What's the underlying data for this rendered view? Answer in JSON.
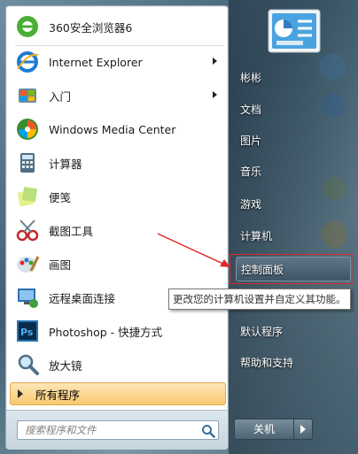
{
  "left_items": [
    {
      "label": "360安全浏览器6",
      "icon": "360-browser-icon",
      "arrow": false
    },
    {
      "label": "Internet Explorer",
      "icon": "internet-explorer-icon",
      "arrow": true
    },
    {
      "label": "入门",
      "icon": "getting-started-icon",
      "arrow": true
    },
    {
      "label": "Windows Media Center",
      "icon": "media-center-icon",
      "arrow": false
    },
    {
      "label": "计算器",
      "icon": "calculator-icon",
      "arrow": false
    },
    {
      "label": "便笺",
      "icon": "sticky-notes-icon",
      "arrow": false
    },
    {
      "label": "截图工具",
      "icon": "snipping-tool-icon",
      "arrow": false
    },
    {
      "label": "画图",
      "icon": "paint-icon",
      "arrow": false
    },
    {
      "label": "远程桌面连接",
      "icon": "remote-desktop-icon",
      "arrow": false
    },
    {
      "label": "Photoshop - 快捷方式",
      "icon": "photoshop-icon",
      "arrow": false
    },
    {
      "label": "放大镜",
      "icon": "magnifier-icon",
      "arrow": false
    }
  ],
  "all_programs": "所有程序",
  "search": {
    "placeholder": "搜索程序和文件"
  },
  "right_items": [
    {
      "label": "彬彬"
    },
    {
      "label": "文档"
    },
    {
      "label": "图片"
    },
    {
      "label": "音乐"
    },
    {
      "label": "游戏"
    },
    {
      "label": "计算机"
    },
    {
      "label": "控制面板"
    },
    {
      "label": "默认程序"
    },
    {
      "label": "帮助和支持"
    }
  ],
  "shutdown": {
    "label": "关机"
  },
  "tooltip": "更改您的计算机设置并自定义其功能。",
  "colors": {
    "annotation": "#e0282a",
    "all_programs_bg": "#f8c96e"
  }
}
